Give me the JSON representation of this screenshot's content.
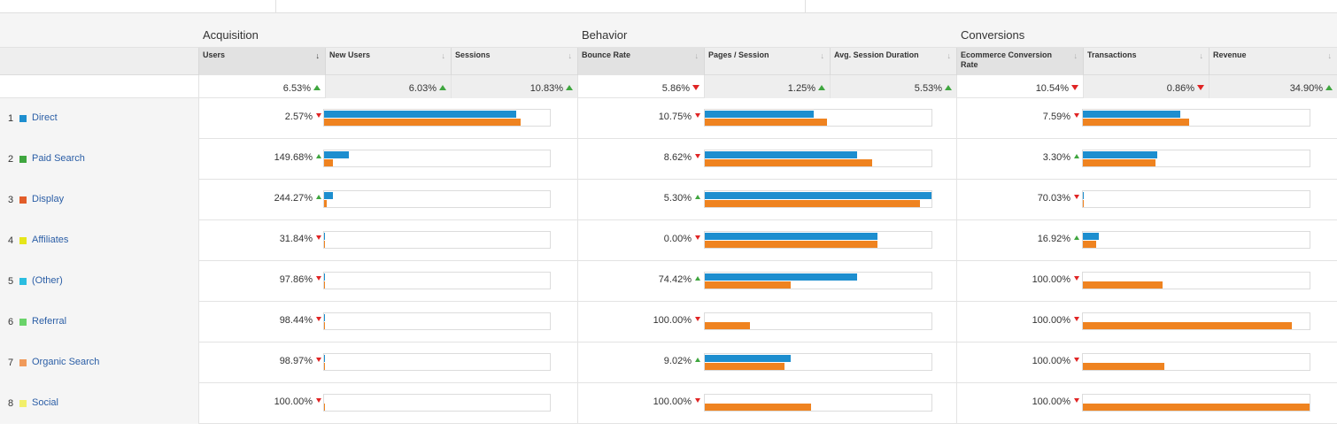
{
  "groups": {
    "acquisition": "Acquisition",
    "behavior": "Behavior",
    "conversions": "Conversions"
  },
  "metrics": [
    {
      "label": "Users",
      "sorted": true
    },
    {
      "label": "New Users",
      "sorted": false
    },
    {
      "label": "Sessions",
      "sorted": false
    },
    {
      "label": "Bounce Rate",
      "sorted": false
    },
    {
      "label": "Pages / Session",
      "sorted": false
    },
    {
      "label": "Avg. Session Duration",
      "sorted": false
    },
    {
      "label": "Ecommerce Conversion Rate",
      "sorted": false
    },
    {
      "label": "Transactions",
      "sorted": false
    },
    {
      "label": "Revenue",
      "sorted": false
    }
  ],
  "summary": [
    {
      "value": "6.53%",
      "trend": "up"
    },
    {
      "value": "6.03%",
      "trend": "up"
    },
    {
      "value": "10.83%",
      "trend": "up"
    },
    {
      "value": "5.86%",
      "trend": "down"
    },
    {
      "value": "1.25%",
      "trend": "up"
    },
    {
      "value": "5.53%",
      "trend": "up"
    },
    {
      "value": "10.54%",
      "trend": "down"
    },
    {
      "value": "0.86%",
      "trend": "down"
    },
    {
      "value": "34.90%",
      "trend": "up"
    }
  ],
  "rows": [
    {
      "num": "1",
      "name": "Direct",
      "color": "#1d8ecf",
      "users": {
        "value": "2.57%",
        "trend": "down"
      },
      "users_bar": [
        0.85,
        0.87
      ],
      "bounce": {
        "value": "10.75%",
        "trend": "down"
      },
      "pages_bar": [
        0.48,
        0.54
      ],
      "conv": {
        "value": "7.59%",
        "trend": "down"
      },
      "trans_bar": [
        0.43,
        0.47
      ]
    },
    {
      "num": "2",
      "name": "Paid Search",
      "color": "#3fa63f",
      "users": {
        "value": "149.68%",
        "trend": "up"
      },
      "users_bar": [
        0.11,
        0.04
      ],
      "bounce": {
        "value": "8.62%",
        "trend": "down"
      },
      "pages_bar": [
        0.67,
        0.74
      ],
      "conv": {
        "value": "3.30%",
        "trend": "up"
      },
      "trans_bar": [
        0.33,
        0.32
      ]
    },
    {
      "num": "3",
      "name": "Display",
      "color": "#e25d2a",
      "users": {
        "value": "244.27%",
        "trend": "up"
      },
      "users_bar": [
        0.04,
        0.01
      ],
      "bounce": {
        "value": "5.30%",
        "trend": "up"
      },
      "pages_bar": [
        1.0,
        0.95
      ],
      "conv": {
        "value": "70.03%",
        "trend": "down"
      },
      "trans_bar": [
        0.005,
        0.005
      ]
    },
    {
      "num": "4",
      "name": "Affiliates",
      "color": "#e6e61a",
      "users": {
        "value": "31.84%",
        "trend": "down"
      },
      "users_bar": [
        0.005,
        0.005
      ],
      "bounce": {
        "value": "0.00%",
        "trend": "down"
      },
      "pages_bar": [
        0.76,
        0.76
      ],
      "conv": {
        "value": "16.92%",
        "trend": "up"
      },
      "trans_bar": [
        0.07,
        0.06
      ]
    },
    {
      "num": "5",
      "name": "(Other)",
      "color": "#2bbde0",
      "users": {
        "value": "97.86%",
        "trend": "down"
      },
      "users_bar": [
        0.005,
        0.005
      ],
      "bounce": {
        "value": "74.42%",
        "trend": "up"
      },
      "pages_bar": [
        0.67,
        0.38
      ],
      "conv": {
        "value": "100.00%",
        "trend": "down"
      },
      "trans_bar": [
        0.0,
        0.35
      ]
    },
    {
      "num": "6",
      "name": "Referral",
      "color": "#6ad36a",
      "users": {
        "value": "98.44%",
        "trend": "down"
      },
      "users_bar": [
        0.005,
        0.005
      ],
      "bounce": {
        "value": "100.00%",
        "trend": "down"
      },
      "pages_bar": [
        0.0,
        0.2
      ],
      "conv": {
        "value": "100.00%",
        "trend": "down"
      },
      "trans_bar": [
        0.0,
        0.92
      ]
    },
    {
      "num": "7",
      "name": "Organic Search",
      "color": "#f09a5a",
      "users": {
        "value": "98.97%",
        "trend": "down"
      },
      "users_bar": [
        0.005,
        0.005
      ],
      "bounce": {
        "value": "9.02%",
        "trend": "up"
      },
      "pages_bar": [
        0.38,
        0.35
      ],
      "conv": {
        "value": "100.00%",
        "trend": "down"
      },
      "trans_bar": [
        0.0,
        0.36
      ]
    },
    {
      "num": "8",
      "name": "Social",
      "color": "#f2ef6a",
      "users": {
        "value": "100.00%",
        "trend": "down"
      },
      "users_bar": [
        0.0,
        0.005
      ],
      "bounce": {
        "value": "100.00%",
        "trend": "down"
      },
      "pages_bar": [
        0.0,
        0.47
      ],
      "conv": {
        "value": "100.00%",
        "trend": "down"
      },
      "trans_bar": [
        0.0,
        1.0
      ]
    }
  ]
}
